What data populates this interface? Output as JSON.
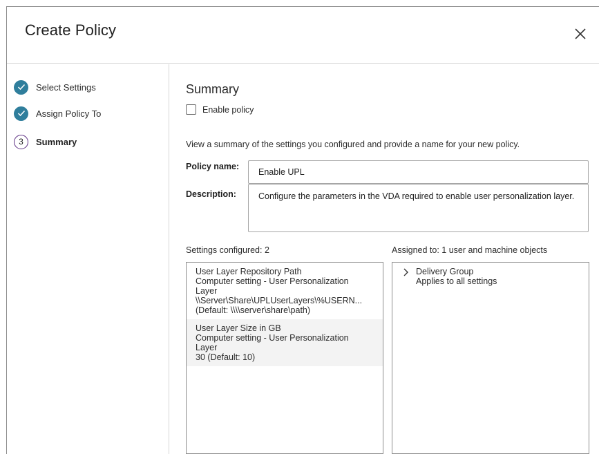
{
  "dialog": {
    "title": "Create Policy",
    "close_icon": "close-icon"
  },
  "colors": {
    "accent": "#2f7e9c",
    "current_step": "#5b2d82",
    "border": "#a6a6a6"
  },
  "steps": [
    {
      "label": "Select Settings",
      "state": "done",
      "icon": "check-icon"
    },
    {
      "label": "Assign Policy To",
      "state": "done",
      "icon": "check-icon"
    },
    {
      "label": "Summary",
      "state": "current",
      "number": "3"
    }
  ],
  "summary": {
    "title": "Summary",
    "enable_policy_label": "Enable policy",
    "enable_policy_checked": false,
    "intro": "View a summary of the settings you configured and provide a name for your new policy.",
    "policy_name_label": "Policy name:",
    "policy_name_value": "Enable UPL",
    "description_label": "Description:",
    "description_value": "Configure the parameters in the VDA required to enable user personalization layer.",
    "settings_header": "Settings configured: 2",
    "assigned_header": "Assigned to: 1 user and machine objects",
    "settings": [
      {
        "name": "User Layer Repository Path",
        "category_line1": "Computer setting - User Personalization",
        "category_line2": "Layer",
        "value": "\\\\Server\\Share\\UPLUserLayers\\%USERN...",
        "default": "(Default: \\\\\\\\server\\share\\path)"
      },
      {
        "name": "User Layer Size in GB",
        "category_line1": "Computer setting - User Personalization",
        "category_line2": "Layer",
        "value": "30 (Default: 10)"
      }
    ],
    "assigned": [
      {
        "name": "Delivery Group",
        "detail": "Applies to all settings",
        "icon": "chevron-right-icon"
      }
    ]
  }
}
